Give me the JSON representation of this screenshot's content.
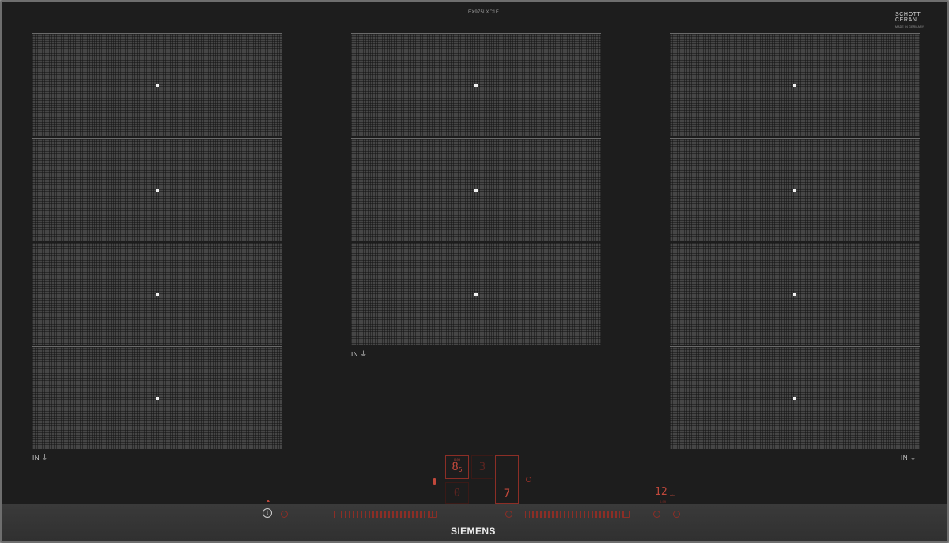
{
  "hob": {
    "model_code": "EX975LXC1E",
    "brand_logo": {
      "line1": "SCHOTT",
      "line2": "CERAN",
      "sub": "MADE IN GERMANY"
    },
    "manufacturer": "SIEMENS"
  },
  "zone_labels": {
    "left": "IN",
    "center": "IN",
    "right": "IN"
  },
  "controls": {
    "info_icon": "info-icon",
    "display_main": "8",
    "display_main_sub": "5",
    "display_main_top": "0-99",
    "display_secondary": "3",
    "display_lower_left": "0",
    "display_lower_right": "7",
    "timer_value": "12",
    "timer_unit": "min",
    "timer_sub": "0-99"
  },
  "colors": {
    "accent_red": "#c0483b",
    "panel": "#1d1d1d",
    "zone": "#464646"
  }
}
